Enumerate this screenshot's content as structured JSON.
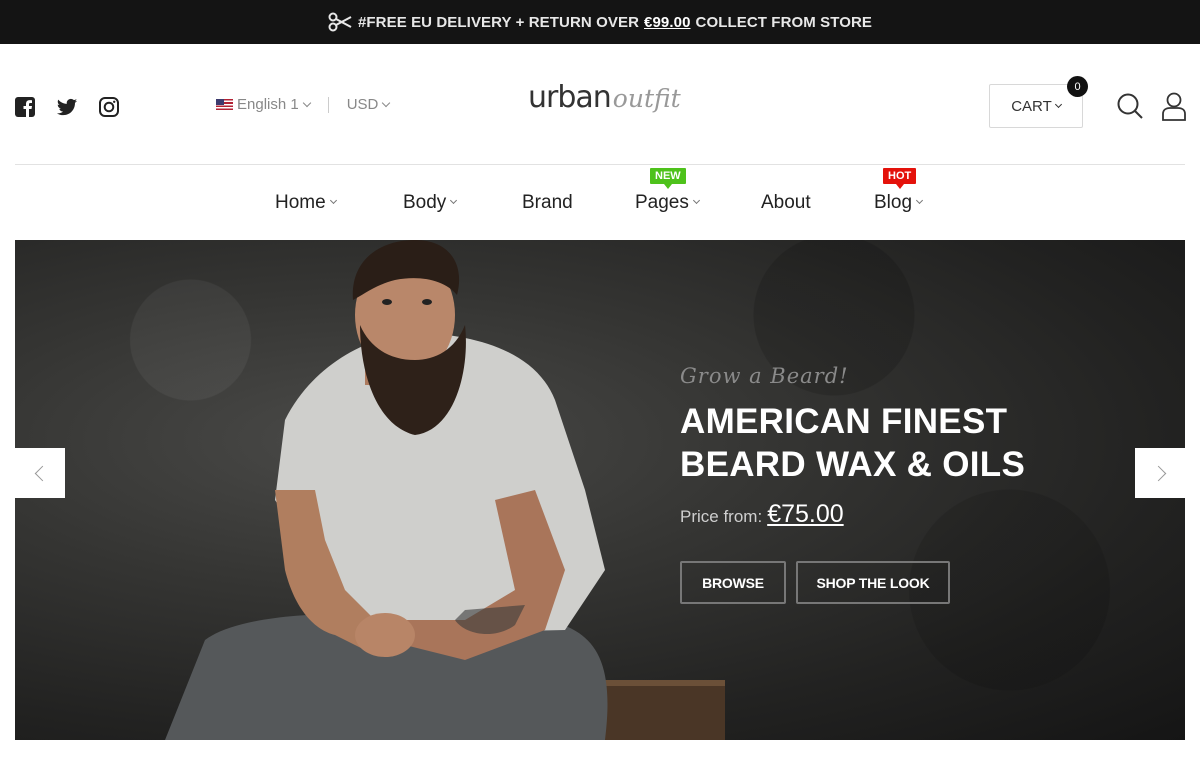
{
  "topbar": {
    "text_before": "#FREE EU DELIVERY + RETURN OVER",
    "threshold": "€99.00",
    "text_after": "COLLECT FROM STORE"
  },
  "header": {
    "social": [
      "facebook-icon",
      "twitter-icon",
      "instagram-icon"
    ],
    "language": "English 1",
    "currency": "USD",
    "logo": {
      "word1": "urban",
      "word2": "outfit"
    },
    "cart_label": "CART",
    "cart_count": "0"
  },
  "nav": {
    "items": [
      {
        "label": "Home",
        "dropdown": true
      },
      {
        "label": "Body",
        "dropdown": true
      },
      {
        "label": "Brand",
        "dropdown": false
      },
      {
        "label": "Pages",
        "dropdown": true,
        "badge": "NEW"
      },
      {
        "label": "About",
        "dropdown": false
      },
      {
        "label": "Blog",
        "dropdown": true,
        "badge": "HOT"
      }
    ]
  },
  "hero": {
    "tagline": "Grow a Beard!",
    "headline_line1": "AMERICAN FINEST",
    "headline_line2": "BEARD WAX & OILS",
    "price_label": "Price from:",
    "price_value": "€75.00",
    "btn_browse": "BROWSE",
    "btn_look": "SHOP THE LOOK"
  },
  "colors": {
    "topbar": "#141414",
    "badge_new": "#4ec21b",
    "badge_hot": "#e4120b",
    "hero_bg": "#2a2a29"
  }
}
